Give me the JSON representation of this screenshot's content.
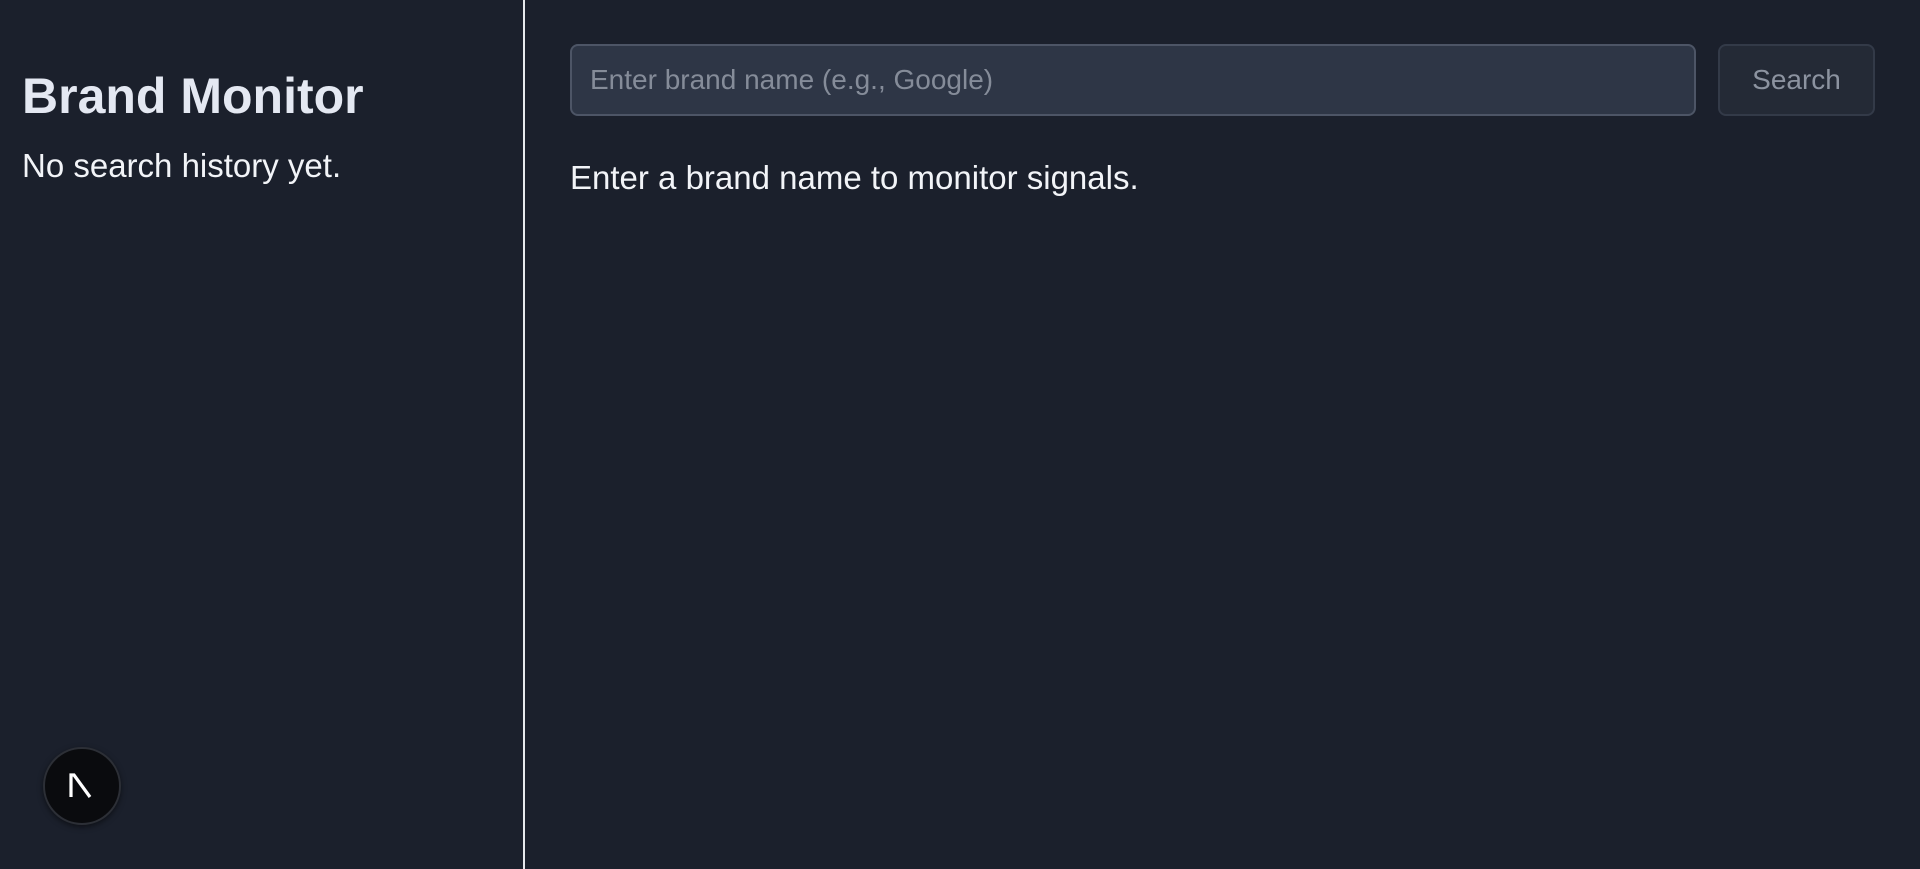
{
  "sidebar": {
    "title": "Brand Monitor",
    "history_empty_text": "No search history yet.",
    "badge_icon": "nextjs-logo-icon",
    "badge_letter": "N"
  },
  "search": {
    "placeholder": "Enter brand name (e.g., Google)",
    "value": "",
    "button_label": "Search"
  },
  "main": {
    "prompt_text": "Enter a brand name to monitor signals."
  },
  "colors": {
    "background": "#1b202c",
    "input_background": "#2e3646",
    "button_background": "#242a36",
    "divider": "#e6e8ec",
    "text": "#f2f4f8"
  }
}
